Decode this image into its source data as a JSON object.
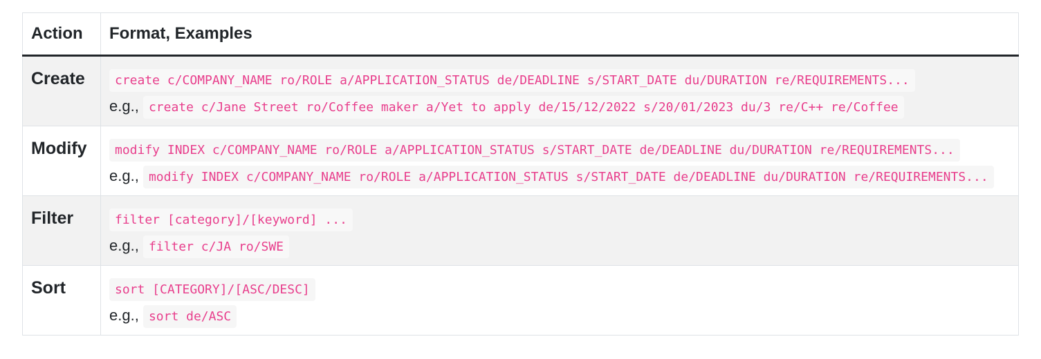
{
  "header": {
    "action": "Action",
    "format": "Format, Examples"
  },
  "rows": [
    {
      "action": "Create",
      "format": "create c/COMPANY_NAME ro/ROLE a/APPLICATION_STATUS de/DEADLINE s/START_DATE du/DURATION re/REQUIREMENTS...",
      "eg_label": "e.g.,",
      "example": "create c/Jane Street ro/Coffee maker a/Yet to apply de/15/12/2022 s/20/01/2023 du/3 re/C++ re/Coffee"
    },
    {
      "action": "Modify",
      "format": "modify INDEX c/COMPANY_NAME ro/ROLE a/APPLICATION_STATUS s/START_DATE de/DEADLINE du/DURATION re/REQUIREMENTS...",
      "eg_label": "e.g.,",
      "example": "modify INDEX c/COMPANY_NAME ro/ROLE a/APPLICATION_STATUS s/START_DATE de/DEADLINE du/DURATION re/REQUIREMENTS..."
    },
    {
      "action": "Filter",
      "format": "filter [category]/[keyword] ...",
      "eg_label": "e.g.,",
      "example": "filter c/JA ro/SWE"
    },
    {
      "action": "Sort",
      "format": "sort [CATEGORY]/[ASC/DESC]",
      "eg_label": "e.g.,",
      "example": "sort de/ASC"
    }
  ]
}
